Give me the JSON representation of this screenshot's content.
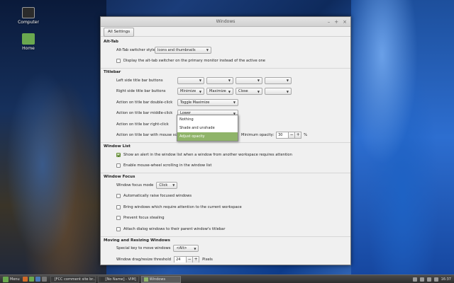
{
  "desktop": {
    "icons": [
      {
        "label": "Computer"
      },
      {
        "label": "Home"
      }
    ]
  },
  "window": {
    "title": "Windows",
    "controls": {
      "minimize": "–",
      "maximize": "+",
      "close": "×"
    },
    "toolbar": {
      "all_settings": "All Settings"
    }
  },
  "alttab": {
    "title": "Alt-Tab",
    "style_label": "Alt-Tab switcher style",
    "style_value": "Icons and thumbnails",
    "primary_monitor_label": "Display the alt-tab switcher on the primary monitor instead of the active one"
  },
  "titlebar": {
    "title": "Titlebar",
    "left_buttons_label": "Left side title bar buttons",
    "left_buttons": [
      "",
      "",
      "",
      ""
    ],
    "right_buttons_label": "Right side title bar buttons",
    "right_buttons": [
      "Minimize",
      "Maximize",
      "Close",
      ""
    ],
    "double_click_label": "Action on title bar double-click",
    "double_click_value": "Toggle Maximize",
    "middle_click_label": "Action on title bar middle-click",
    "middle_click_value": "Lower",
    "right_click_label": "Action on title bar right-click",
    "scroll_label": "Action on title bar with mouse scroll",
    "min_opacity_label": "Minimum opacity:",
    "min_opacity_value": "30",
    "opacity_unit": "%",
    "spin_minus": "−",
    "spin_plus": "+"
  },
  "popup": {
    "options": [
      "Nothing",
      "Shade and unshade",
      "Adjust opacity"
    ],
    "selected": "Adjust opacity"
  },
  "windowlist": {
    "title": "Window List",
    "alert_label": "Show an alert in the window list when a window from another workspace requires attention",
    "alert_checked": true,
    "scroll_label": "Enable mouse-wheel scrolling in the window list",
    "scroll_checked": false
  },
  "focus": {
    "title": "Window Focus",
    "mode_label": "Window focus mode",
    "mode_value": "Click",
    "raise_label": "Automatically raise focused windows",
    "bring_label": "Bring windows which require attention to the current workspace",
    "prevent_label": "Prevent focus stealing",
    "attach_label": "Attach dialog windows to their parent window's titlebar"
  },
  "moving": {
    "title": "Moving and Resizing Windows",
    "special_key_label": "Special key to move windows",
    "special_key_value": "<Alt>",
    "threshold_label": "Window drag/resize threshold",
    "threshold_value": "24",
    "threshold_unit": "Pixels"
  },
  "taskbar": {
    "menu_label": "Menu",
    "tasks": [
      {
        "label": "[FCC comment site br..."
      },
      {
        "label": "[No Name] - VIM]"
      },
      {
        "label": "Windows"
      }
    ],
    "clock": "16:37"
  },
  "colors": {
    "accent": "#8fb469",
    "mint_green": "#6aa84f"
  }
}
